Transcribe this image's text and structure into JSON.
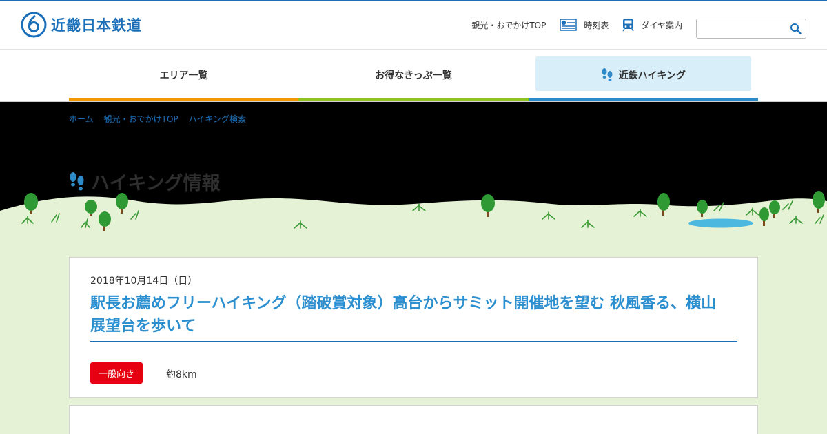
{
  "header": {
    "logo_text": "近畿日本鉄道",
    "links": [
      {
        "label": "観光・おでかけTOP",
        "icon": "none"
      },
      {
        "label": "時刻表",
        "icon": "timetable-icon"
      },
      {
        "label": "ダイヤ案内",
        "icon": "train-icon"
      }
    ],
    "search": {
      "placeholder": "",
      "value": ""
    }
  },
  "nav": {
    "items": [
      {
        "label": "エリア一覧",
        "accent": "#f39800"
      },
      {
        "label": "お得なきっぷ一覧",
        "accent": "#8dc21f"
      },
      {
        "label": "近鉄ハイキング",
        "accent": "#2e8bc9",
        "active": true
      }
    ]
  },
  "breadcrumb": [
    "ホーム",
    "観光・おでかけTOP",
    "ハイキング検索"
  ],
  "hero": {
    "title": "ハイキング情報"
  },
  "event": {
    "date": "2018年10月14日（日）",
    "title": "駅長お薦めフリーハイキング（踏破賞対象）高台からサミット開催地を望む 秋風香る、横山展望台を歩いて",
    "level": "一般向き",
    "distance": "約8km"
  },
  "colors": {
    "brand": "#1a6fb8",
    "title_blue": "#2b8fd0",
    "badge_red": "#e60012",
    "ground_green": "#e6f2d6",
    "tree_green": "#2f9a33",
    "pond_blue": "#4cb8e0"
  }
}
